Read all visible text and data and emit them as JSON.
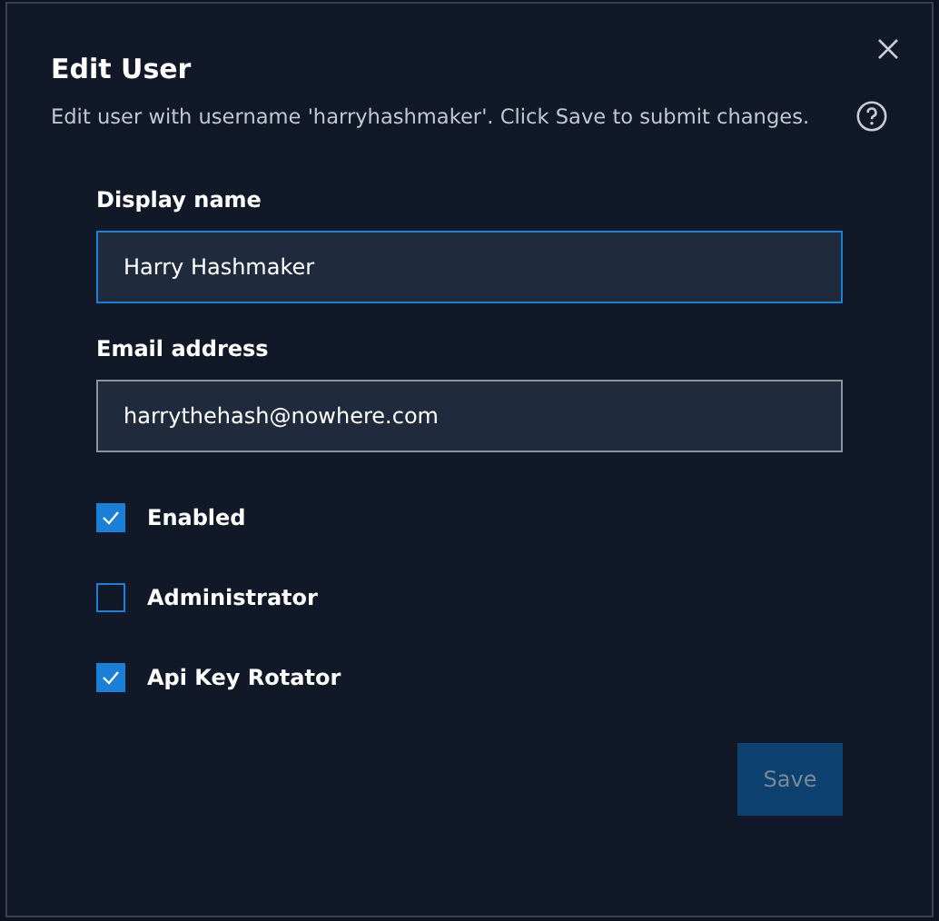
{
  "dialog": {
    "title": "Edit User",
    "subtitle": "Edit user with username 'harryhashmaker'. Click Save to submit changes."
  },
  "fields": [
    {
      "label": "Display name",
      "value": "Harry Hashmaker",
      "focused": true
    },
    {
      "label": "Email address",
      "value": "harrythehash@nowhere.com",
      "focused": false
    }
  ],
  "options": [
    {
      "label": "Enabled",
      "checked": true
    },
    {
      "label": "Administrator",
      "checked": false
    },
    {
      "label": "Api Key Rotator",
      "checked": true
    }
  ],
  "save_button": {
    "label": "Save",
    "disabled": true
  }
}
